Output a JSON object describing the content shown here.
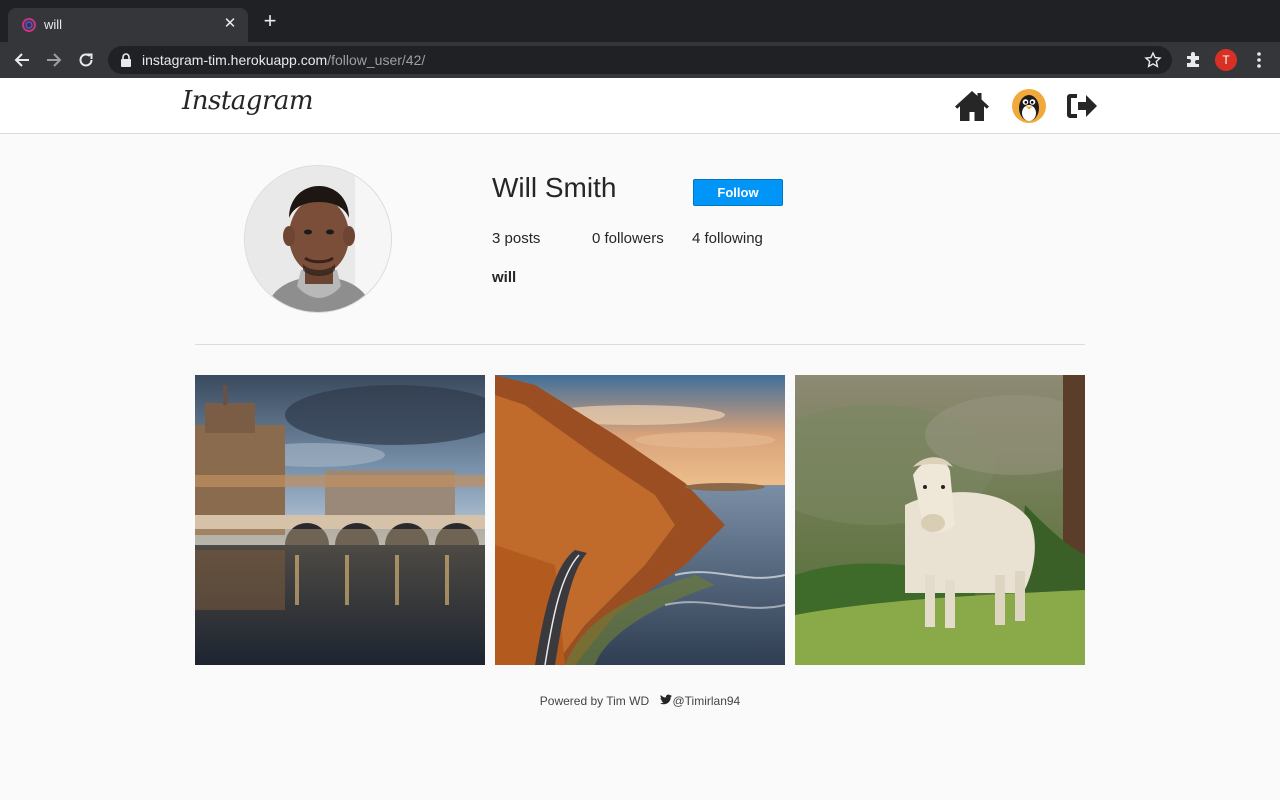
{
  "browser": {
    "tab_title": "will",
    "url_host": "instagram-tim.herokuapp.com",
    "url_path": "/follow_user/42/",
    "profile_initial": "T"
  },
  "header": {
    "logo_text": "Instagram"
  },
  "profile": {
    "name": "Will Smith",
    "follow_label": "Follow",
    "posts": "3 posts",
    "followers": "0 followers",
    "following": "4 following",
    "handle": "will"
  },
  "posts": [
    {
      "scene": "castle-bridge-river-dusk"
    },
    {
      "scene": "coastal-cliff-road-sunset"
    },
    {
      "scene": "white-pony-green-field"
    }
  ],
  "footer": {
    "powered_by": "Powered by Tim WD",
    "twitter": "@Timirlan94"
  },
  "colors": {
    "follow_button": "#0095f6",
    "chrome_dark": "#202124",
    "chrome_tab": "#35363a"
  }
}
